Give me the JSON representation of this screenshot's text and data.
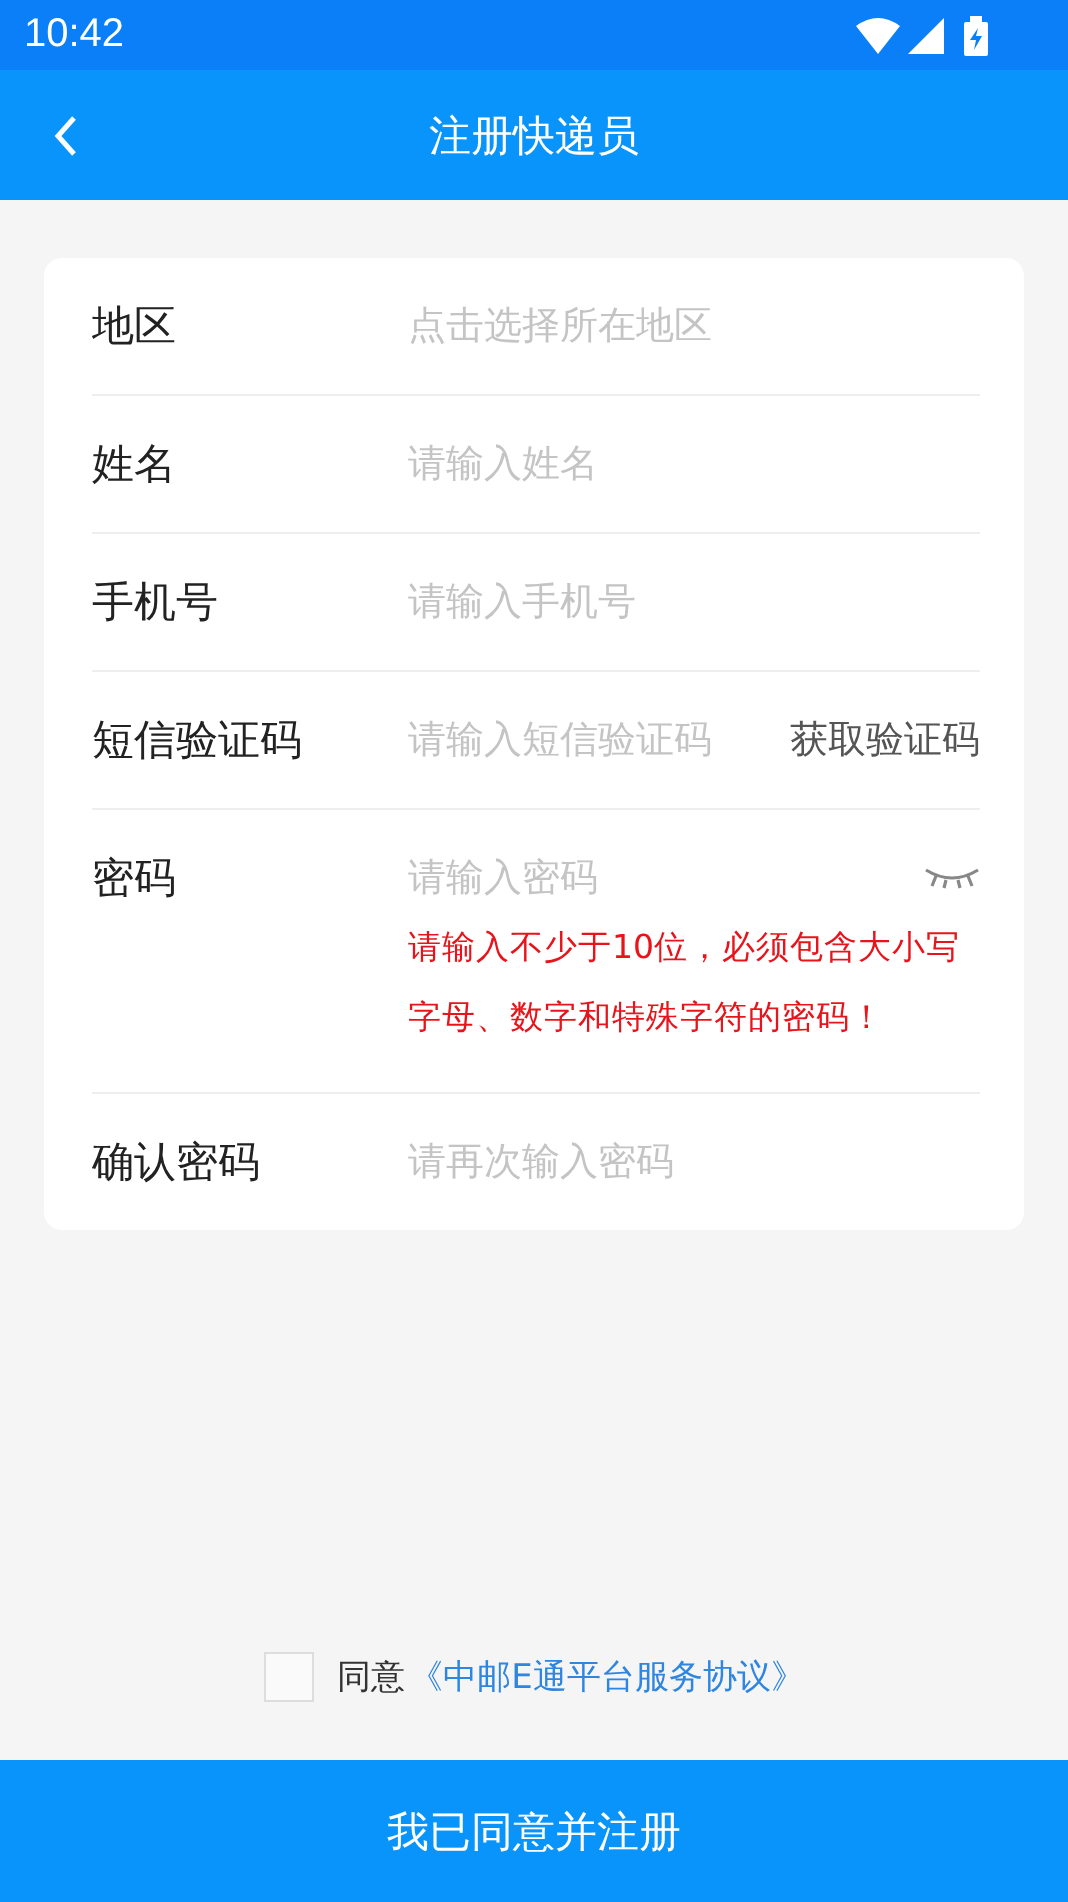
{
  "status_bar": {
    "time": "10:42"
  },
  "header": {
    "title": "注册快递员"
  },
  "fields": [
    {
      "kind": "picker",
      "label": "地区",
      "placeholder": "点击选择所在地区"
    },
    {
      "kind": "text",
      "label": "姓名",
      "placeholder": "请输入姓名"
    },
    {
      "kind": "text",
      "label": "手机号",
      "placeholder": "请输入手机号"
    },
    {
      "kind": "code",
      "label": "短信验证码",
      "placeholder": "请输入短信验证码",
      "action": "获取验证码"
    },
    {
      "kind": "password",
      "label": "密码",
      "placeholder": "请输入密码",
      "hint": "请输入不少于10位，必须包含大小写字母、数字和特殊字符的密码！"
    },
    {
      "kind": "text",
      "label": "确认密码",
      "placeholder": "请再次输入密码"
    }
  ],
  "agreement": {
    "checked": false,
    "text": "同意",
    "link": "《中邮E通平台服务协议》"
  },
  "submit_button": "我已同意并注册"
}
